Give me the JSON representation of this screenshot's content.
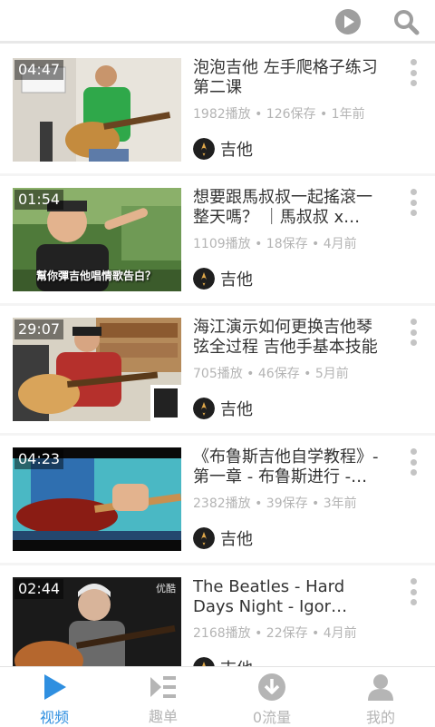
{
  "header": {},
  "feed": [
    {
      "duration": "04:47",
      "title": "泡泡吉他 左手爬格子练习第二课",
      "meta": "1982播放 • 126保存 • 1年前",
      "channel": "吉他"
    },
    {
      "duration": "01:54",
      "title": "想要跟馬叔叔一起搖滾一整天嗎？ ｜馬叔叔 x…",
      "meta": "1109播放 • 18保存 • 4月前",
      "channel": "吉他",
      "thumb_caption": "幫你彈吉他唱情歌告白？"
    },
    {
      "duration": "29:07",
      "title": "海江演示如何更换吉他琴弦全过程 吉他手基本技能",
      "meta": "705播放 • 46保存 • 5月前",
      "channel": "吉他"
    },
    {
      "duration": "04:23",
      "title": "《布鲁斯吉他自学教程》- 第一章 - 布鲁斯进行 -…",
      "meta": "2382播放 • 39保存 • 3年前",
      "channel": "吉他"
    },
    {
      "duration": "02:44",
      "title": "The Beatles - Hard Days Night - Igor…",
      "meta": "2168播放 • 22保存 • 4月前",
      "channel": "吉他",
      "thumb_watermark": "优酷"
    }
  ],
  "tabs": [
    {
      "label": "视频",
      "icon": "play-icon",
      "active": true
    },
    {
      "label": "趣单",
      "icon": "playlist-icon",
      "active": false
    },
    {
      "label": "0流量",
      "icon": "download-icon",
      "active": false
    },
    {
      "label": "我的",
      "icon": "person-icon",
      "active": false
    }
  ],
  "colors": {
    "accent": "#2f8fe0",
    "inactive": "#b5b5b5",
    "text": "#333333",
    "meta": "#b4b4b4"
  }
}
